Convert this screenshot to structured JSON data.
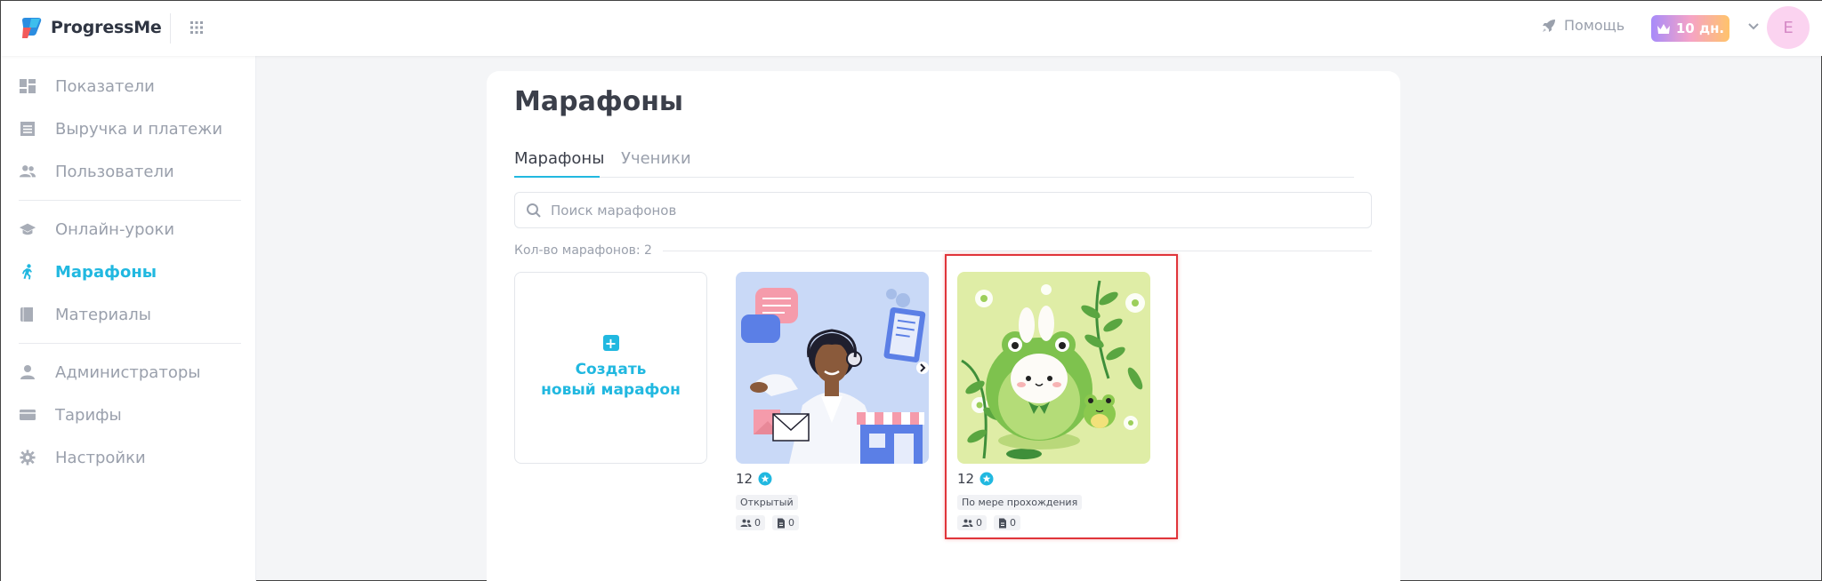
{
  "app": {
    "name": "ProgressMe",
    "brand_color": "#21b8e0"
  },
  "topbar": {
    "help_label": "Помощь",
    "trial_label": "10 дн.",
    "avatar_letter": "E"
  },
  "sidebar": {
    "items": [
      {
        "label": "Показатели",
        "icon": "dashboard-icon"
      },
      {
        "label": "Выручка и платежи",
        "icon": "receipt-icon"
      },
      {
        "label": "Пользователи",
        "icon": "users-icon"
      },
      {
        "label": "Онлайн-уроки",
        "icon": "graduation-cap-icon"
      },
      {
        "label": "Марафоны",
        "icon": "runner-icon",
        "active": true
      },
      {
        "label": "Материалы",
        "icon": "book-icon"
      },
      {
        "label": "Администраторы",
        "icon": "person-icon"
      },
      {
        "label": "Тарифы",
        "icon": "card-icon"
      },
      {
        "label": "Настройки",
        "icon": "gear-icon"
      }
    ]
  },
  "main": {
    "title": "Марафоны",
    "tabs": [
      {
        "label": "Марафоны",
        "active": true
      },
      {
        "label": "Ученики",
        "active": false
      }
    ],
    "search": {
      "placeholder": "Поиск марафонов",
      "value": ""
    },
    "count_label": "Кол-во марафонов: 2",
    "create_tile": {
      "line1": "Создать",
      "line2": "новый марафон"
    },
    "marathons": [
      {
        "count": "12",
        "tag": "Открытый",
        "students": "0",
        "materials": "0",
        "image": "support-operator-illustration"
      },
      {
        "count": "12",
        "tag": "По мере прохождения",
        "students": "0",
        "materials": "0",
        "image": "green-frog-bunny-illustration",
        "highlighted": true
      }
    ]
  }
}
